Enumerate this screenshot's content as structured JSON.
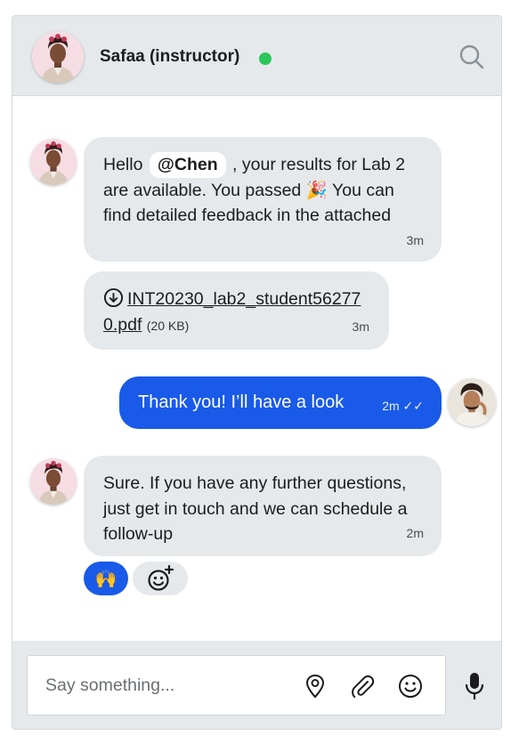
{
  "header": {
    "contact_name": "Safaa (instructor)",
    "status_color": "#2bc65a",
    "search_icon": "search-icon"
  },
  "messages": [
    {
      "id": "m1",
      "direction": "incoming",
      "text_before": "Hello",
      "mention": "@Chen",
      "text_after": ", your results for Lab 2 are available. You passed 🎉 You can find detailed feedback in the attached",
      "time": "3m"
    },
    {
      "id": "m2",
      "direction": "incoming",
      "file_name": "INT20230_lab2_student562770.pdf",
      "file_size": "(20 KB)",
      "icon": "download-icon",
      "time": "3m"
    },
    {
      "id": "m3",
      "direction": "outgoing",
      "text": "Thank you! I’ll have a look",
      "time": "2m ✓✓"
    },
    {
      "id": "m4",
      "direction": "incoming",
      "text": "Sure. If you have any further questions, just get in touch and we can schedule a follow-up",
      "time": "2m"
    }
  ],
  "reactions": {
    "raised_hands": "🙌",
    "add_reaction_icon": "add-reaction-icon"
  },
  "composer": {
    "placeholder": "Say something...",
    "value": "",
    "icons": [
      "location-pin-icon",
      "paperclip-icon",
      "smiley-icon",
      "microphone-icon"
    ]
  },
  "colors": {
    "accent": "#1a5ae8",
    "bubble_incoming": "#e6e9eb",
    "header_bg": "#e6e9eb",
    "online": "#2bc65a"
  }
}
